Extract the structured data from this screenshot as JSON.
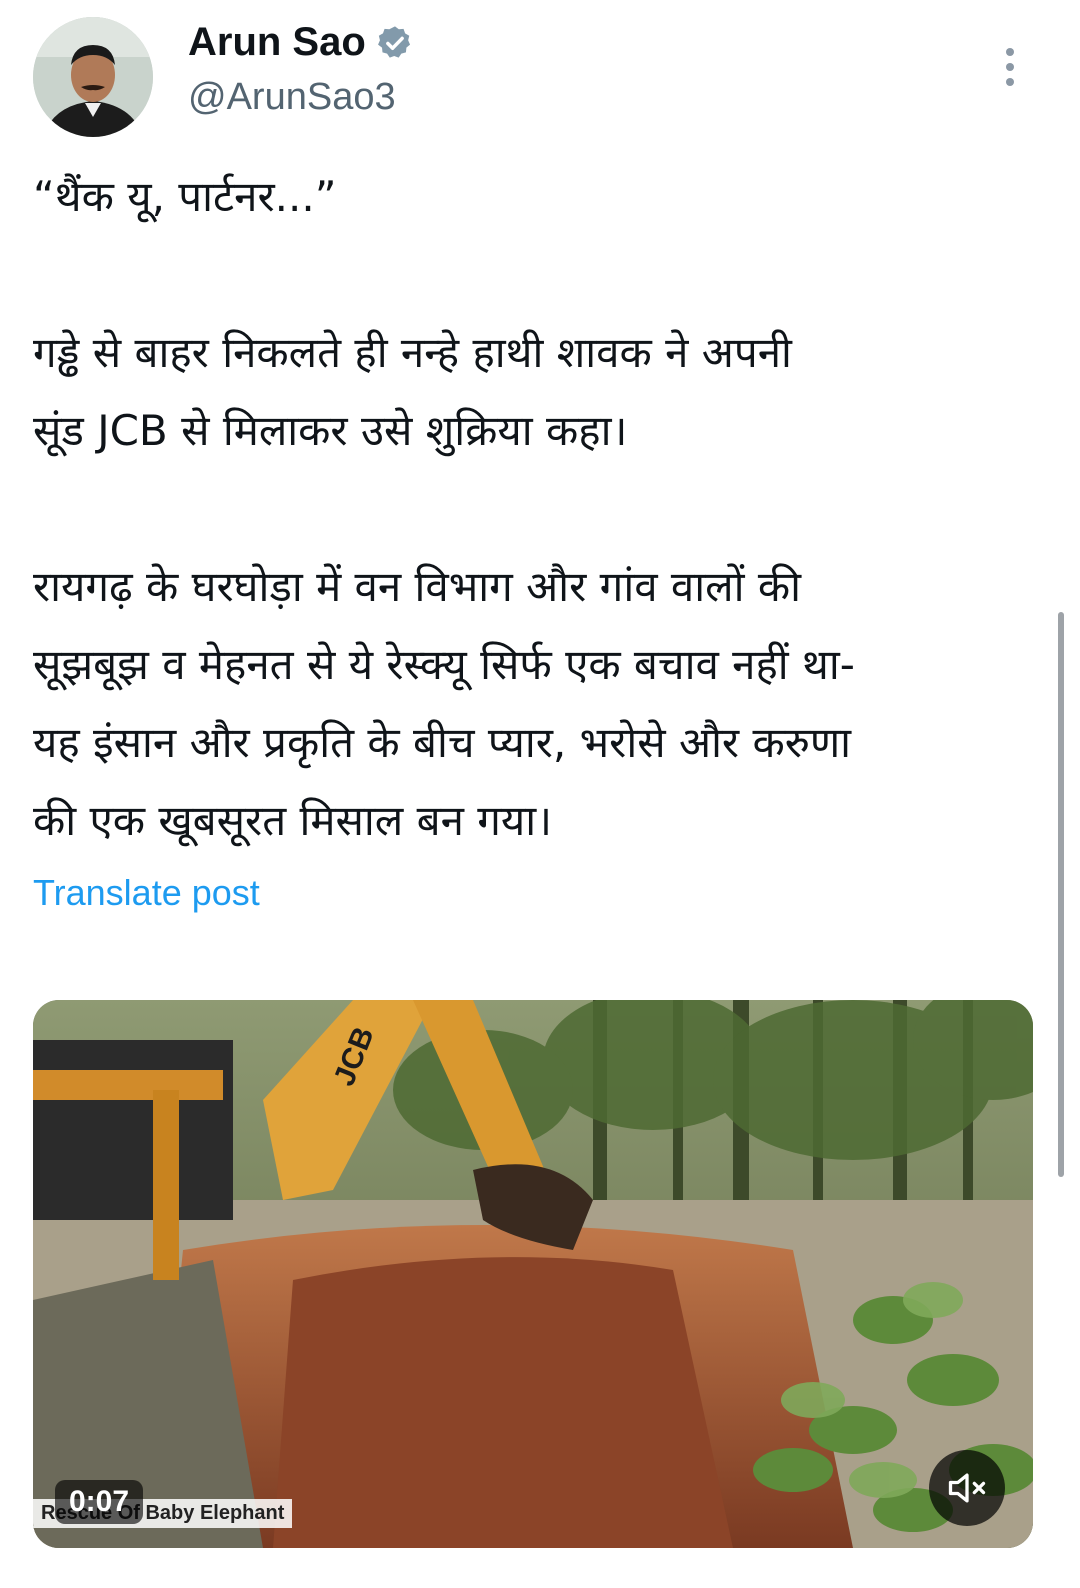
{
  "author": {
    "name": "Arun Sao",
    "handle": "@ArunSao3",
    "verified": true
  },
  "icons": {
    "verified": "verified-badge-icon",
    "more": "more-vertical-icon",
    "mute": "volume-muted-icon"
  },
  "post": {
    "line1": "“थैंक यू, पार्टनर...”",
    "para2_line1": "गड्ढे से बाहर निकलते ही नन्हे हाथी शावक ने अपनी",
    "para2_line2": "सूंड JCB से मिलाकर उसे शुक्रिया कहा।",
    "para3_line1": "रायगढ़ के घरघोड़ा में वन विभाग और गांव वालों की",
    "para3_line2": "सूझबूझ व मेहनत से ये रेस्क्यू सिर्फ एक बचाव नहीं था-",
    "para3_line3": "यह इंसान और प्रकृति के बीच प्यार, भरोसे और करुणा",
    "para3_line4": "की एक खूबसूरत मिसाल बन गया।"
  },
  "translate_label": "Translate post",
  "media": {
    "duration": "0:07",
    "caption": "Rescue Of Baby Elephant",
    "jcb_text": "JCB"
  },
  "colors": {
    "link": "#1d9bf0",
    "handle": "#536471",
    "verified": "#829aab"
  }
}
